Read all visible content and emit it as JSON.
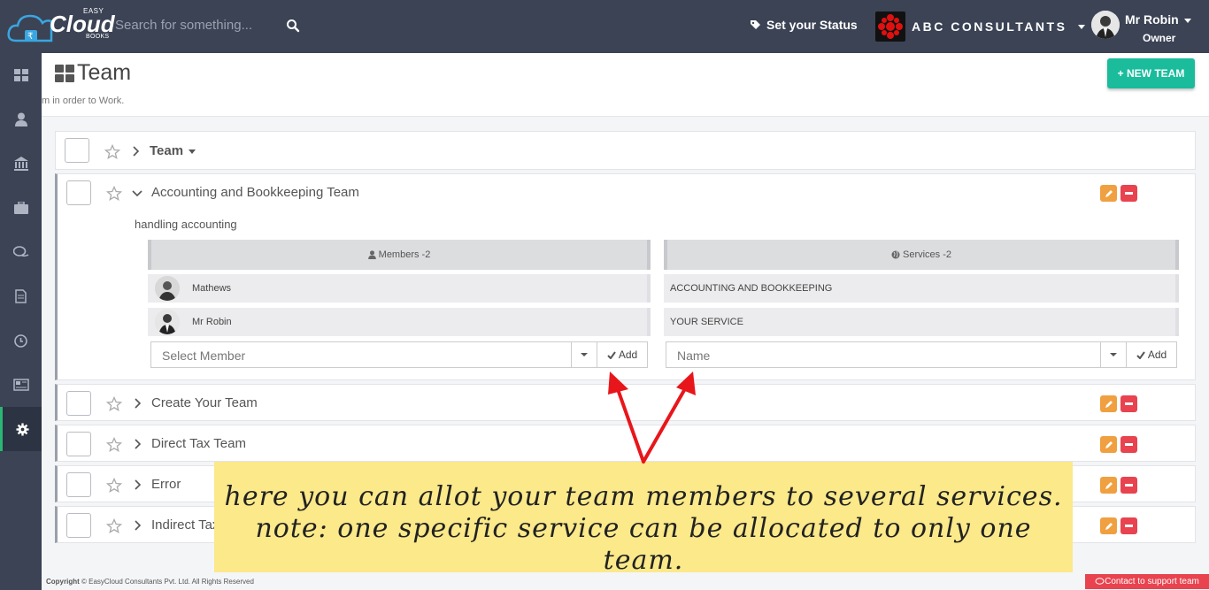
{
  "brand": {
    "easy": "EASY",
    "name": "Cloud",
    "books": "BOOKS"
  },
  "search": {
    "placeholder": "Search for something..."
  },
  "topbar": {
    "status_label": "Set your Status",
    "company": "ABC CONSULTANTS",
    "user_name": "Mr Robin",
    "user_role": "Owner"
  },
  "sidebar": {
    "icons": [
      "dashboard-icon",
      "user-icon",
      "bank-icon",
      "briefcase-icon",
      "chat-icon",
      "document-icon",
      "clock-icon",
      "newspaper-icon",
      "settings-icon"
    ],
    "active": "settings-icon"
  },
  "page": {
    "title": "Team",
    "subtitle": "m in order to Work.",
    "new_button": "+ NEW TEAM"
  },
  "list": {
    "header": "Team",
    "expanded": {
      "name": "Accounting and Bookkeeping Team",
      "description": "handling accounting",
      "members_label": "Members -2",
      "services_label": "Services -2",
      "members": [
        "Mathews",
        "Mr Robin"
      ],
      "services": [
        "ACCOUNTING AND BOOKKEEPING",
        "YOUR SERVICE"
      ],
      "member_placeholder": "Select Member",
      "service_placeholder": "Name",
      "add_label": "Add"
    },
    "teams": [
      "Create Your Team",
      "Direct Tax Team",
      "Error",
      "Indirect Tax Team"
    ]
  },
  "annotation": {
    "line1": "here you can allot your team members to several services.",
    "line2": "note: one specific service can be allocated to only one team."
  },
  "footer": {
    "copyright_bold": "Copyright",
    "copyright": "© EasyCloud Consultants Pvt. Ltd. All Rights Reserved",
    "support": "Contact to support team"
  },
  "colors": {
    "topbar": "#3b4355",
    "accent": "#1abc9c",
    "edit": "#f0a040",
    "delete": "#e8434f",
    "note": "#fbe98a",
    "arrow": "#e8161b"
  }
}
